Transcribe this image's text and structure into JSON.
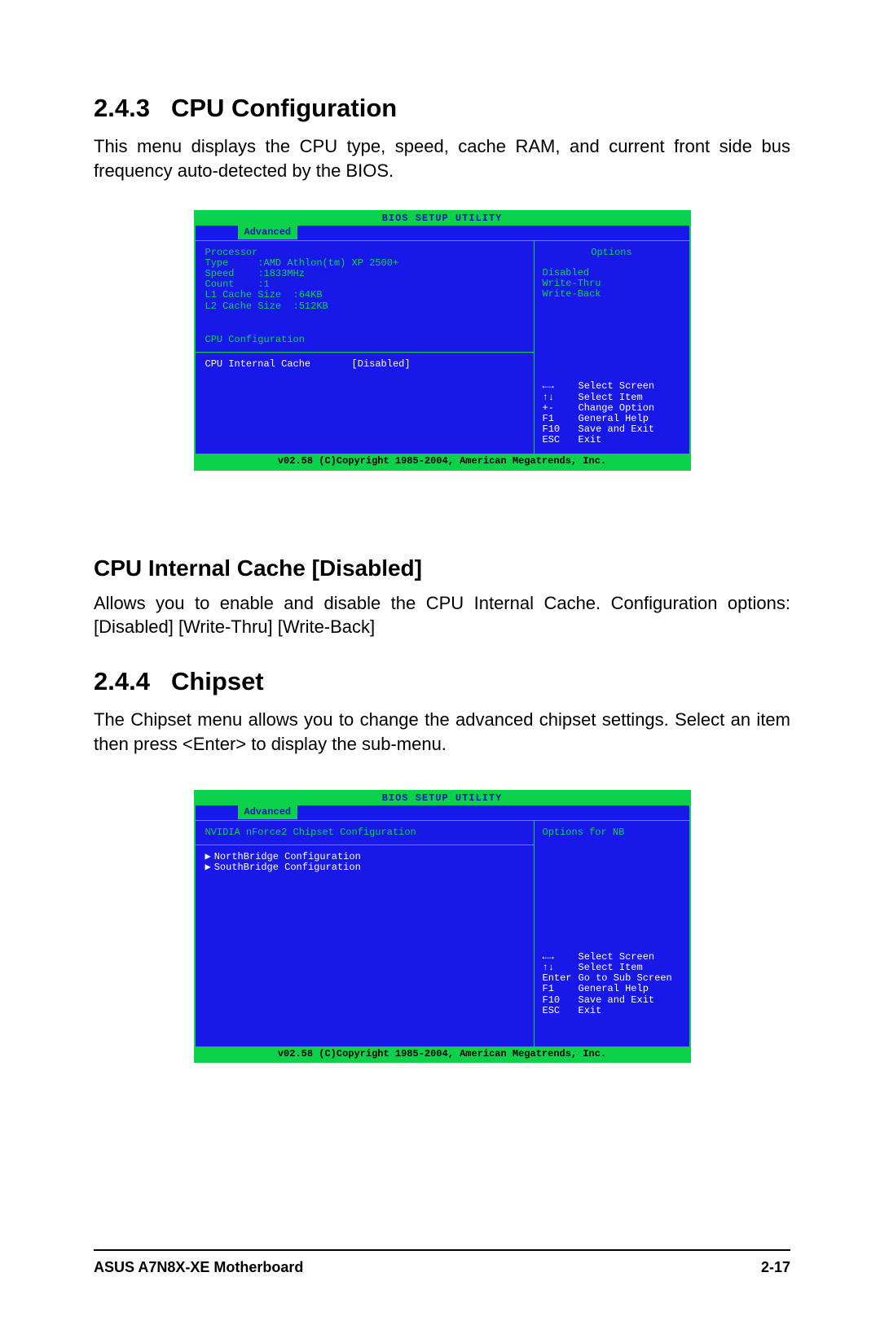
{
  "section1": {
    "number": "2.4.3",
    "title": "CPU Configuration",
    "body": "This menu displays the CPU type, speed, cache RAM, and current front side bus frequency auto-detected by the BIOS."
  },
  "bios1": {
    "header": "BIOS SETUP UTILITY",
    "tab": "Advanced",
    "cpu": {
      "processor_label": "Processor",
      "type_label": "Type",
      "type_value": ":AMD Athlon(tm) XP 2500+",
      "speed_label": "Speed",
      "speed_value": ":1833MHz",
      "count_label": "Count",
      "count_value": ":1",
      "l1_label": "L1 Cache Size",
      "l1_value": ":64KB",
      "l2_label": "L2 Cache Size",
      "l2_value": ":512KB"
    },
    "config_title": "CPU Configuration",
    "item_label": "CPU Internal Cache",
    "item_value": "[Disabled]",
    "options_title": "Options",
    "options": [
      "Disabled",
      "Write-Thru",
      "Write-Back"
    ],
    "help": [
      {
        "key": "←→",
        "text": "Select Screen"
      },
      {
        "key": "↑↓",
        "text": "Select Item"
      },
      {
        "key": "+-",
        "text": "Change Option"
      },
      {
        "key": "F1",
        "text": "General Help"
      },
      {
        "key": "F10",
        "text": "Save and Exit"
      },
      {
        "key": "ESC",
        "text": "Exit"
      }
    ],
    "footer": "v02.58 (C)Copyright 1985-2004, American Megatrends, Inc."
  },
  "subsection": {
    "title": "CPU Internal Cache [Disabled]",
    "body": "Allows you to enable and disable the CPU Internal Cache. Configuration options: [Disabled] [Write-Thru] [Write-Back]"
  },
  "section2": {
    "number": "2.4.4",
    "title": "Chipset",
    "body": "The Chipset menu allows you to change the advanced chipset settings. Select an item then press <Enter> to display the sub-menu."
  },
  "bios2": {
    "header": "BIOS SETUP UTILITY",
    "tab": "Advanced",
    "chipset_title": "NVIDIA nForce2 Chipset Configuration",
    "submenus": [
      "NorthBridge Configuration",
      "SouthBridge Configuration"
    ],
    "right_title": "Options for NB",
    "help": [
      {
        "key": "←→",
        "text": "Select Screen"
      },
      {
        "key": "↑↓",
        "text": "Select Item"
      },
      {
        "key": "Enter",
        "text": "Go to Sub Screen"
      },
      {
        "key": "F1",
        "text": "General Help"
      },
      {
        "key": "F10",
        "text": "Save and Exit"
      },
      {
        "key": "ESC",
        "text": "Exit"
      }
    ],
    "footer": "v02.58 (C)Copyright 1985-2004, American Megatrends, Inc."
  },
  "footer": {
    "left": "ASUS A7N8X-XE Motherboard",
    "right": "2-17"
  }
}
